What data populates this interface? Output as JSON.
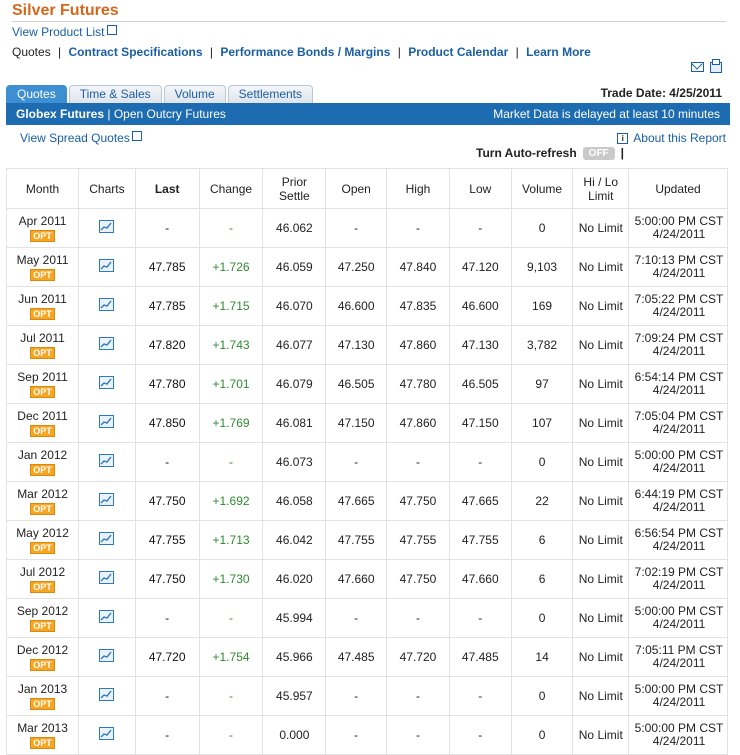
{
  "header": {
    "title": "Silver Futures",
    "product_list_link": "View Product List"
  },
  "nav": {
    "current": "Quotes",
    "links": [
      "Contract Specifications",
      "Performance Bonds / Margins",
      "Product Calendar",
      "Learn More"
    ]
  },
  "tabs": [
    "Quotes",
    "Time & Sales",
    "Volume",
    "Settlements"
  ],
  "trade_date": "Trade Date: 4/25/2011",
  "bar": {
    "globex": "Globex Futures",
    "separator": "|",
    "outcry": "Open Outcry Futures",
    "delay_note": "Market Data is delayed at least 10 minutes"
  },
  "spread_link": "View Spread Quotes",
  "about_link": "About this Report",
  "refresh": {
    "label": "Turn Auto-refresh",
    "state": "OFF",
    "trail": "|"
  },
  "table": {
    "headers": {
      "month": "Month",
      "charts": "Charts",
      "last": "Last",
      "change": "Change",
      "prior_settle": "Prior Settle",
      "open": "Open",
      "high": "High",
      "low": "Low",
      "volume": "Volume",
      "hi_lo_limit": "Hi / Lo Limit",
      "updated": "Updated"
    },
    "opt_label": "OPT",
    "rows": [
      {
        "month": "Apr 2011",
        "last": "-",
        "change": "-",
        "prior": "46.062",
        "open": "-",
        "high": "-",
        "low": "-",
        "volume": "0",
        "limit": "No Limit",
        "time": "5:00:00 PM CST",
        "date": "4/24/2011"
      },
      {
        "month": "May 2011",
        "last": "47.785",
        "change": "+1.726",
        "prior": "46.059",
        "open": "47.250",
        "high": "47.840",
        "low": "47.120",
        "volume": "9,103",
        "limit": "No Limit",
        "time": "7:10:13 PM CST",
        "date": "4/24/2011"
      },
      {
        "month": "Jun 2011",
        "last": "47.785",
        "change": "+1.715",
        "prior": "46.070",
        "open": "46.600",
        "high": "47.835",
        "low": "46.600",
        "volume": "169",
        "limit": "No Limit",
        "time": "7:05:22 PM CST",
        "date": "4/24/2011"
      },
      {
        "month": "Jul 2011",
        "last": "47.820",
        "change": "+1.743",
        "prior": "46.077",
        "open": "47.130",
        "high": "47.860",
        "low": "47.130",
        "volume": "3,782",
        "limit": "No Limit",
        "time": "7:09:24 PM CST",
        "date": "4/24/2011"
      },
      {
        "month": "Sep 2011",
        "last": "47.780",
        "change": "+1.701",
        "prior": "46.079",
        "open": "46.505",
        "high": "47.780",
        "low": "46.505",
        "volume": "97",
        "limit": "No Limit",
        "time": "6:54:14 PM CST",
        "date": "4/24/2011"
      },
      {
        "month": "Dec 2011",
        "last": "47.850",
        "change": "+1.769",
        "prior": "46.081",
        "open": "47.150",
        "high": "47.860",
        "low": "47.150",
        "volume": "107",
        "limit": "No Limit",
        "time": "7:05:04 PM CST",
        "date": "4/24/2011"
      },
      {
        "month": "Jan 2012",
        "last": "-",
        "change": "-",
        "prior": "46.073",
        "open": "-",
        "high": "-",
        "low": "-",
        "volume": "0",
        "limit": "No Limit",
        "time": "5:00:00 PM CST",
        "date": "4/24/2011"
      },
      {
        "month": "Mar 2012",
        "last": "47.750",
        "change": "+1.692",
        "prior": "46.058",
        "open": "47.665",
        "high": "47.750",
        "low": "47.665",
        "volume": "22",
        "limit": "No Limit",
        "time": "6:44:19 PM CST",
        "date": "4/24/2011"
      },
      {
        "month": "May 2012",
        "last": "47.755",
        "change": "+1.713",
        "prior": "46.042",
        "open": "47.755",
        "high": "47.755",
        "low": "47.755",
        "volume": "6",
        "limit": "No Limit",
        "time": "6:56:54 PM CST",
        "date": "4/24/2011"
      },
      {
        "month": "Jul 2012",
        "last": "47.750",
        "change": "+1.730",
        "prior": "46.020",
        "open": "47.660",
        "high": "47.750",
        "low": "47.660",
        "volume": "6",
        "limit": "No Limit",
        "time": "7:02:19 PM CST",
        "date": "4/24/2011"
      },
      {
        "month": "Sep 2012",
        "last": "-",
        "change": "-",
        "prior": "45.994",
        "open": "-",
        "high": "-",
        "low": "-",
        "volume": "0",
        "limit": "No Limit",
        "time": "5:00:00 PM CST",
        "date": "4/24/2011"
      },
      {
        "month": "Dec 2012",
        "last": "47.720",
        "change": "+1.754",
        "prior": "45.966",
        "open": "47.485",
        "high": "47.720",
        "low": "47.485",
        "volume": "14",
        "limit": "No Limit",
        "time": "7:05:11 PM CST",
        "date": "4/24/2011"
      },
      {
        "month": "Jan 2013",
        "last": "-",
        "change": "-",
        "prior": "45.957",
        "open": "-",
        "high": "-",
        "low": "-",
        "volume": "0",
        "limit": "No Limit",
        "time": "5:00:00 PM CST",
        "date": "4/24/2011"
      },
      {
        "month": "Mar 2013",
        "last": "-",
        "change": "-",
        "prior": "0.000",
        "open": "-",
        "high": "-",
        "low": "-",
        "volume": "0",
        "limit": "No Limit",
        "time": "5:00:00 PM CST",
        "date": "4/24/2011"
      }
    ]
  },
  "colors": {
    "title_orange": "#d3691d",
    "link_blue": "#1a5fa6",
    "bar_blue": "#1d6bb0",
    "positive_green": "#2e8b2e",
    "opt_orange": "#f6a623"
  },
  "icons": [
    "external-link-icon",
    "email-icon",
    "print-icon",
    "info-icon",
    "chart-icon"
  ]
}
